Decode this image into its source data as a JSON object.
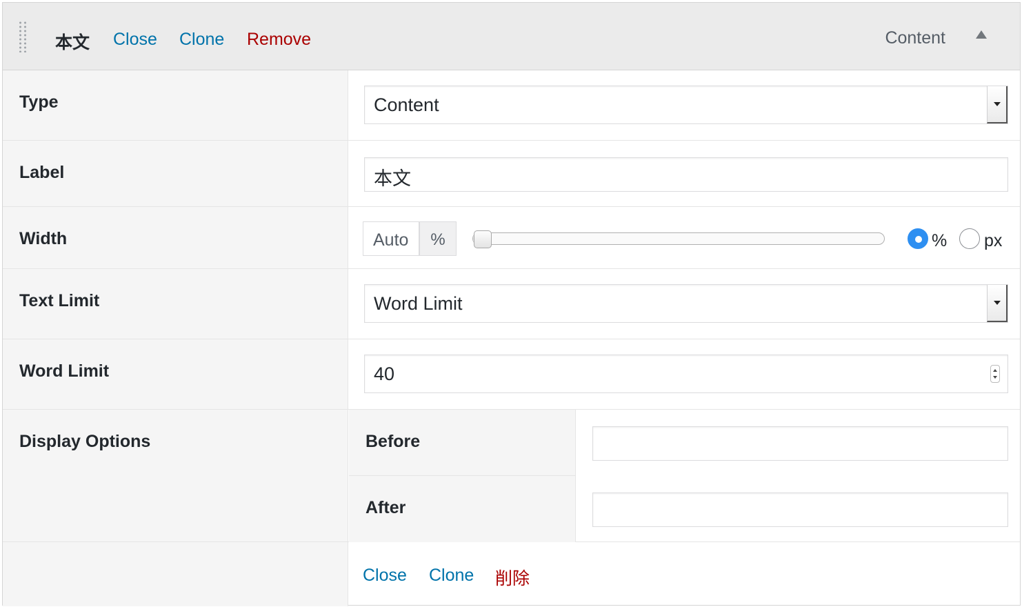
{
  "header": {
    "title": "本文",
    "close_label": "Close",
    "clone_label": "Clone",
    "remove_label": "Remove",
    "type_name": "Content",
    "handle_icon": "drag-handle-icon",
    "toggle_icon": "triangle-up-icon"
  },
  "fields": {
    "type": {
      "label": "Type",
      "value": "Content"
    },
    "label": {
      "label": "Label",
      "value": "本文"
    },
    "width": {
      "label": "Width",
      "auto_text": "Auto",
      "unit_text": "%",
      "slider_value": 0,
      "radio_percent_label": "%",
      "radio_px_label": "px",
      "selected_unit": "%"
    },
    "text_limit": {
      "label": "Text Limit",
      "value": "Word Limit"
    },
    "word_limit": {
      "label": "Word Limit",
      "value": "40"
    },
    "display_options": {
      "label": "Display Options",
      "before_label": "Before",
      "before_value": "",
      "after_label": "After",
      "after_value": ""
    }
  },
  "footer": {
    "close_label": "Close",
    "clone_label": "Clone",
    "remove_label": "削除"
  },
  "colors": {
    "link": "#0073aa",
    "danger": "#aa0000",
    "radio_on": "#2e8ff1"
  }
}
